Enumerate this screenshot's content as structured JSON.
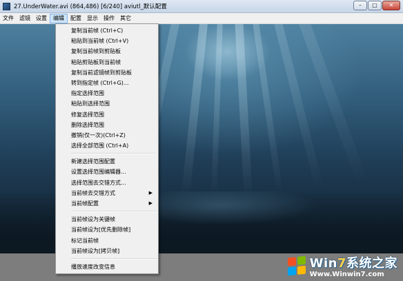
{
  "window": {
    "title": "27.UnderWater.avi (864,486)  [6/240]  aviutl_默认配置",
    "controls": {
      "minimize": "–",
      "maximize": "□",
      "close": "✕"
    }
  },
  "menubar": {
    "items": [
      {
        "id": "file",
        "label": "文件"
      },
      {
        "id": "filter",
        "label": "滤镜"
      },
      {
        "id": "settings",
        "label": "设置"
      },
      {
        "id": "edit",
        "label": "编辑"
      },
      {
        "id": "profile",
        "label": "配置"
      },
      {
        "id": "view",
        "label": "显示"
      },
      {
        "id": "operation",
        "label": "操作"
      },
      {
        "id": "other",
        "label": "其它"
      }
    ],
    "active": "edit"
  },
  "edit_menu": {
    "groups": [
      [
        {
          "label": "复制当前帧 (Ctrl+C)"
        },
        {
          "label": "粘贴到当前帧 (Ctrl+V)"
        },
        {
          "label": "复制当前帧到剪贴板"
        },
        {
          "label": "粘贴剪贴板到当前帧"
        },
        {
          "label": "复制当前滤镜帧到剪贴板"
        },
        {
          "label": "转到指定帧 (Ctrl+G)..."
        },
        {
          "label": "指定选择范围"
        },
        {
          "label": "粘贴到选择范围"
        },
        {
          "label": "修复选择范围"
        },
        {
          "label": "删除选择范围"
        },
        {
          "label": "撤销(仅一次)(Ctrl+Z)"
        },
        {
          "label": "选择全部范围 (Ctrl+A)"
        }
      ],
      [
        {
          "label": "新建选择范围配置"
        },
        {
          "label": "设置选择范围编辑器..."
        },
        {
          "label": "选择范围去交错方式..."
        },
        {
          "label": "当前帧去交错方式",
          "submenu": true
        },
        {
          "label": "当前帧配置",
          "submenu": true
        }
      ],
      [
        {
          "label": "当前帧设为关键帧"
        },
        {
          "label": "当前帧设为[优先删除帧]"
        },
        {
          "label": "标记当前帧"
        },
        {
          "label": "当前帧设为[拷贝帧]"
        }
      ],
      [
        {
          "label": "播放速度改变信息"
        }
      ]
    ],
    "submenu_arrow": "▶"
  },
  "watermark": {
    "brand_prefix": "Win",
    "brand_seven": "7",
    "brand_suffix": "系统之家",
    "url": "Www.Winwin7.com",
    "logo_colors": [
      "#f25022",
      "#7fba00",
      "#00a4ef",
      "#ffb900"
    ]
  }
}
